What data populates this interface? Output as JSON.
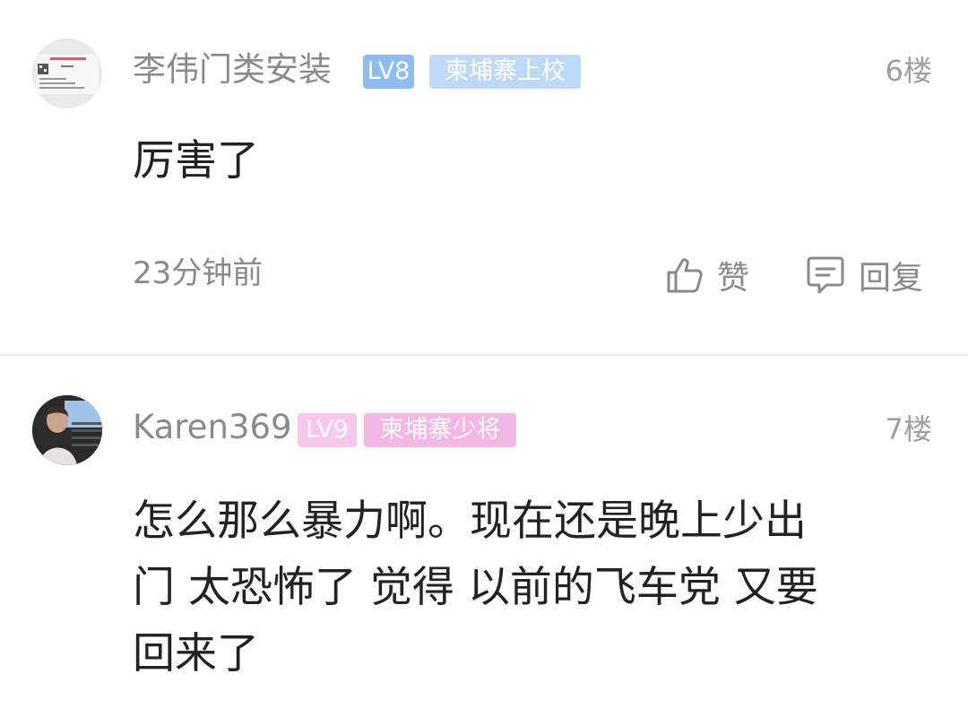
{
  "comments": [
    {
      "username": "李伟门类安装",
      "level": "LV8",
      "rank": "柬埔寨上校",
      "floor": "6楼",
      "content": "厉害了",
      "time": "23分钟前",
      "like_label": "赞",
      "reply_label": "回复",
      "level_color": "#8dbcf3",
      "rank_color": "#bcd9fa"
    },
    {
      "username": "Karen369",
      "level": "LV9",
      "rank": "柬埔寨少将",
      "floor": "7楼",
      "content_lines": [
        "怎么那么暴力啊。现在还是晚上少出",
        "门 太恐怖了 觉得 以前的飞车党 又要",
        "回来了"
      ],
      "level_color": "#f8c8ec",
      "rank_color": "#f4b6e4"
    }
  ],
  "icons": {
    "like": "thumbs-up-icon",
    "reply": "comment-bubble-icon"
  }
}
